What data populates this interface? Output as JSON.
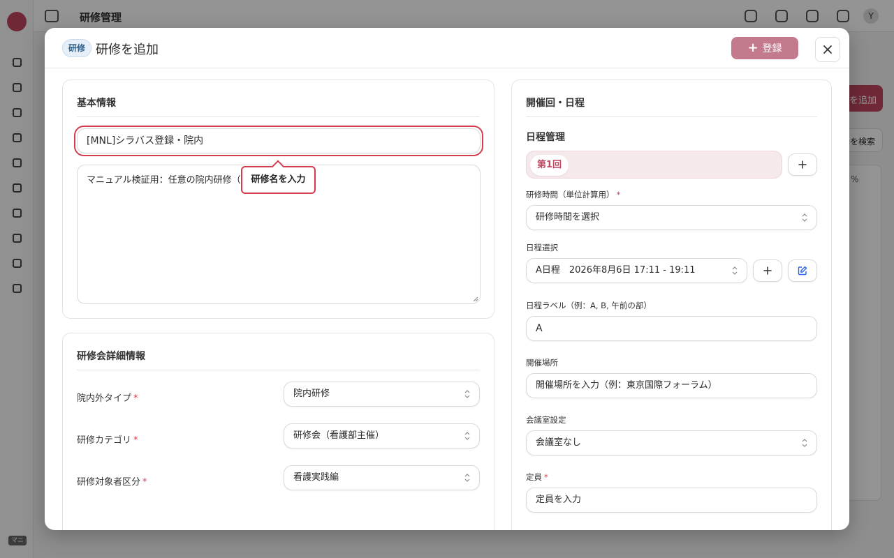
{
  "app": {
    "header_title": "研修管理",
    "user_initial": "Y",
    "bg_add_label": "研修を追加",
    "bg_filter_label": "研修を検索",
    "bg_pct": "%",
    "rail_footer": "マニ"
  },
  "modal": {
    "badge": "研修",
    "title": "研修を追加",
    "register_label": "登録"
  },
  "basic_info": {
    "title": "基本情報",
    "name_value": "[MNL]シラバス登録・院内",
    "description_value": "マニュアル検証用：任意の院内研修（",
    "callout": "研修名を入力"
  },
  "detail_info": {
    "title": "研修会詳細情報",
    "fields": [
      {
        "label": "院内外タイプ",
        "value": "院内研修"
      },
      {
        "label": "研修カテゴリ",
        "value": "研修会（看護部主催）"
      },
      {
        "label": "研修対象者区分",
        "value": "看護実践編"
      }
    ]
  },
  "schedule": {
    "title": "開催回・日程",
    "subtitle": "日程管理",
    "session_tab": "第1回",
    "duration_label": "研修時間（単位計算用）",
    "duration_placeholder": "研修時間を選択",
    "date_select_label": "日程選択",
    "date_select_value": "A日程　2026年8月6日 17:11 - 19:11",
    "date_label_label": "日程ラベル（例：A, B, 午前の部）",
    "date_label_value": "A",
    "venue_label": "開催場所",
    "venue_placeholder": "開催場所を入力（例：東京国際フォーラム）",
    "room_label": "会議室設定",
    "room_value": "会議室なし",
    "capacity_label": "定員",
    "capacity_placeholder": "定員を入力"
  },
  "required_mark": "*",
  "colors": {
    "brand": "#c2455f",
    "register_button": "#c47a8d",
    "highlight": "#d43d50",
    "badge_bg": "#e6eff7",
    "edit_icon": "#2563eb"
  }
}
